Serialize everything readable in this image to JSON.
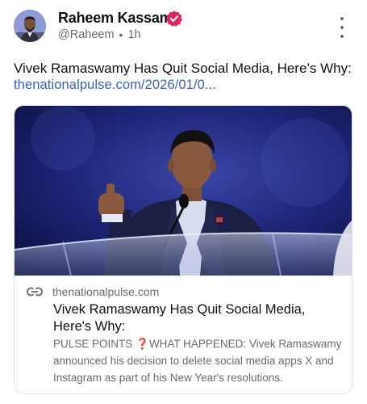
{
  "author": {
    "name": "Raheem Kassam",
    "handle": "@Raheem",
    "time": "1h",
    "separator": "•",
    "verified_color": "#e0245e"
  },
  "post": {
    "text": "Vivek Ramaswamy Has Quit Social Media, Here’s Why:",
    "link": "thenationalpulse.com/2026/01/0..."
  },
  "card": {
    "domain": "thenationalpulse.com",
    "title": "Vivek Ramaswamy Has Quit Social Media, Here's Why:",
    "desc_prefix": "PULSE POINTS ",
    "desc_icon": "❓",
    "desc_rest": "WHAT HAPPENED: Vivek Ramaswamy announced his decision to delete social media apps X and Instagram as part of his New Year's resolutions.",
    "image_icon": "speaker-at-podium-photo"
  },
  "icons": {
    "verified": "verified-badge-icon",
    "more": "more-options-icon",
    "link": "link-icon"
  },
  "colors": {
    "link": "#3a63b8",
    "secondary_text": "#6b6b6b",
    "badge": "#e0245e"
  }
}
